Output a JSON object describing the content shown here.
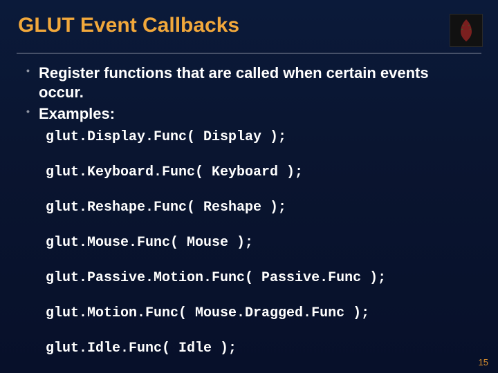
{
  "header": {
    "title": "GLUT Event Callbacks"
  },
  "bullets": [
    "Register functions that are called when certain events occur.",
    "Examples:"
  ],
  "code_lines": [
    "glut.Display.Func( Display );",
    "glut.Keyboard.Func( Keyboard );",
    "glut.Reshape.Func( Reshape );",
    "glut.Mouse.Func( Mouse );",
    "glut.Passive.Motion.Func( Passive.Func );",
    "glut.Motion.Func( Mouse.Dragged.Func );",
    "glut.Idle.Func( Idle );"
  ],
  "page_number": "15"
}
